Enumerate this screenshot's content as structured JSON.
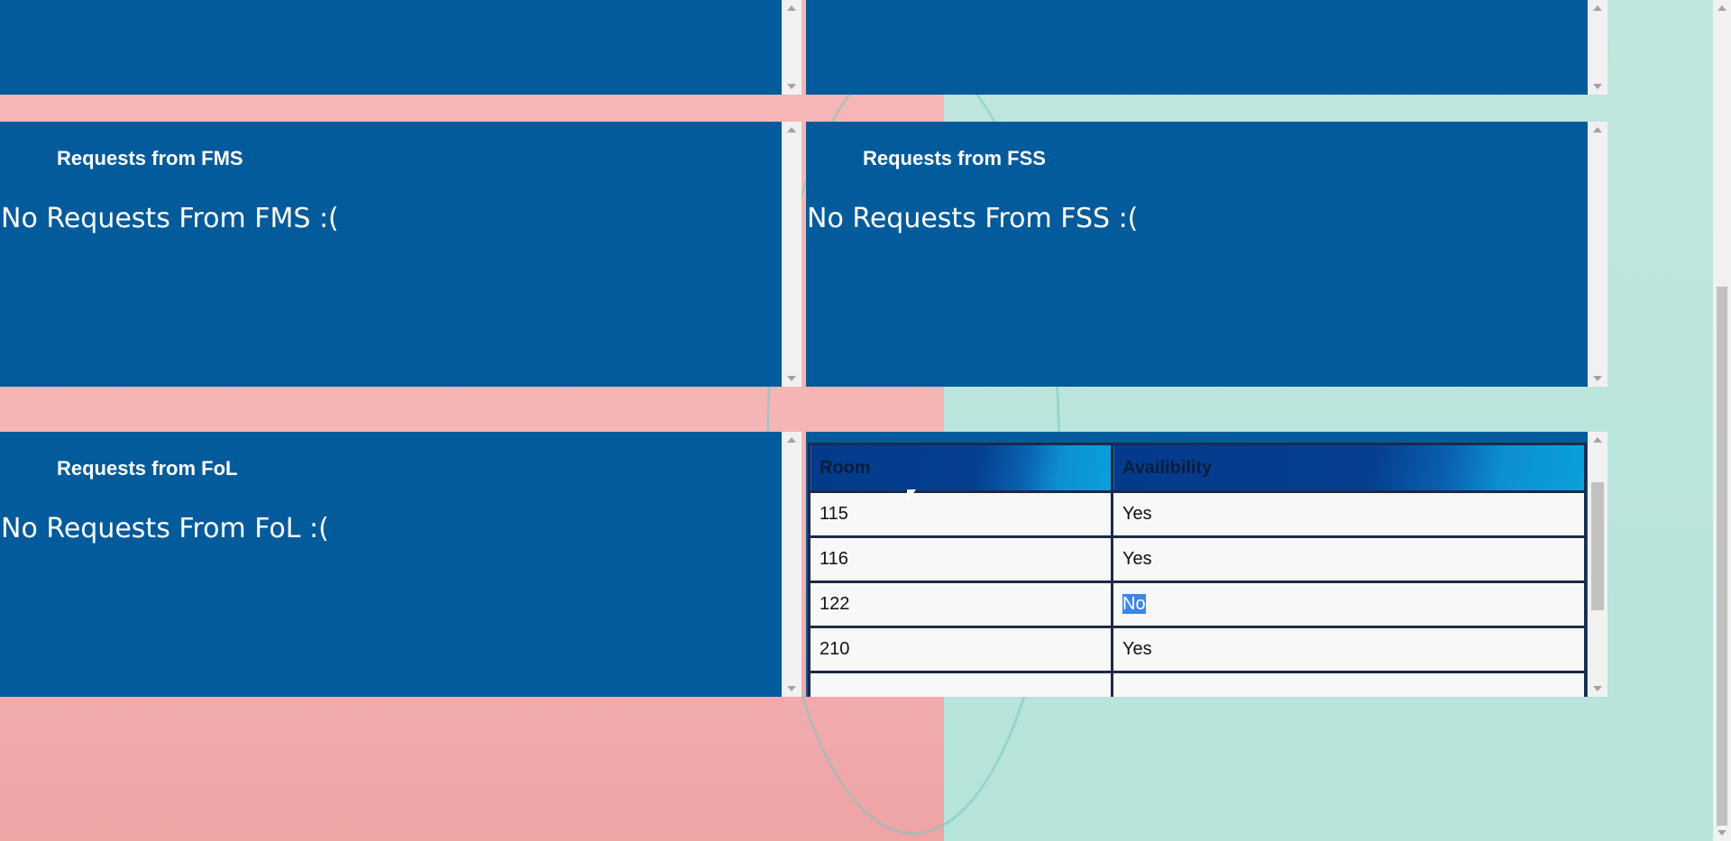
{
  "panels": {
    "fms": {
      "title": "Requests from FMS",
      "message": "No Requests From FMS :("
    },
    "fss": {
      "title": "Requests from FSS",
      "message": "No Requests From FSS :("
    },
    "fol": {
      "title": "Requests from FoL",
      "message": "No Requests From FoL :("
    }
  },
  "room_table": {
    "headers": [
      "Room",
      "Availibility"
    ],
    "rows": [
      {
        "room": "115",
        "availability": "Yes"
      },
      {
        "room": "116",
        "availability": "Yes"
      },
      {
        "room": "122",
        "availability": "No"
      },
      {
        "room": "210",
        "availability": "Yes"
      }
    ],
    "highlighted_cell": "No"
  },
  "colors": {
    "panel_bg": "#045b9c",
    "bg_left": "#f5b4b5",
    "bg_right": "#bfe6df",
    "selection": "#3b86e6"
  }
}
